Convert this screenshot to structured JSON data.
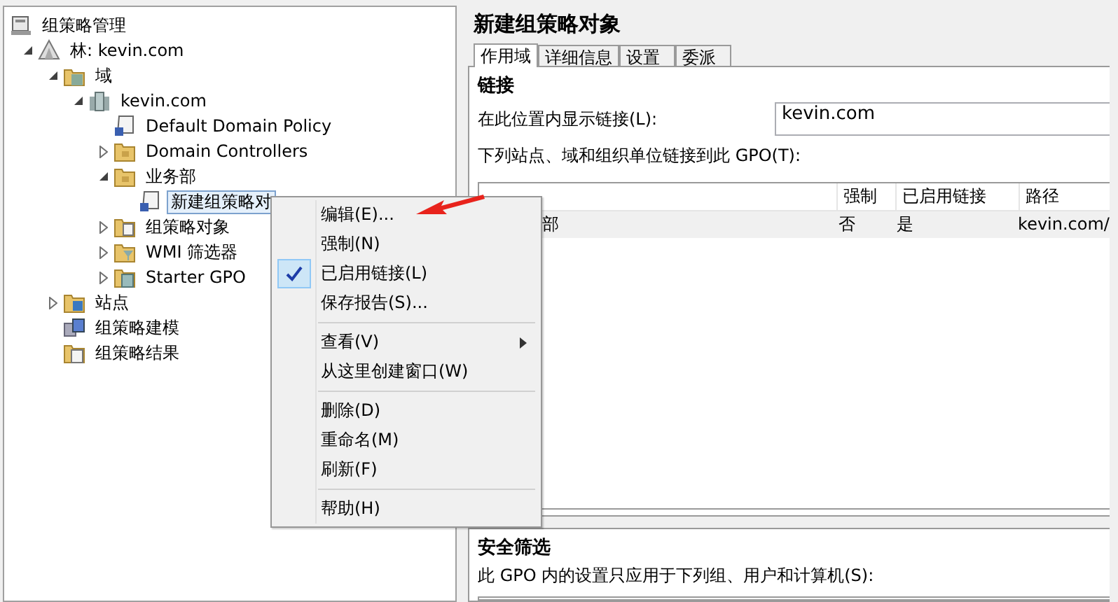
{
  "tree": [
    {
      "label": "组策略管理",
      "kind": "console",
      "selected": false,
      "children": [
        {
          "label": "林: kevin.com",
          "kind": "forest",
          "expanded": true,
          "selected": false,
          "children": [
            {
              "label": "域",
              "kind": "domains",
              "expanded": true,
              "selected": false,
              "children": [
                {
                  "label": "kevin.com",
                  "kind": "domain",
                  "expanded": true,
                  "selected": false,
                  "children": [
                    {
                      "label": "Default Domain Policy",
                      "kind": "gpo",
                      "selected": false
                    },
                    {
                      "label": "Domain Controllers",
                      "kind": "ou",
                      "expanded": false,
                      "selected": false
                    },
                    {
                      "label": "业务部",
                      "kind": "ou",
                      "expanded": true,
                      "selected": false,
                      "children": [
                        {
                          "label": "新建组策略对",
                          "kind": "gpo",
                          "selected": true
                        }
                      ]
                    },
                    {
                      "label": "组策略对象",
                      "kind": "gpofolder",
                      "expanded": false,
                      "selected": false
                    },
                    {
                      "label": "WMI 筛选器",
                      "kind": "wmi",
                      "expanded": false,
                      "selected": false
                    },
                    {
                      "label": "Starter GPO",
                      "kind": "starter",
                      "expanded": false,
                      "selected": false
                    }
                  ]
                }
              ]
            },
            {
              "label": "站点",
              "kind": "sites",
              "expanded": false,
              "selected": false
            },
            {
              "label": "组策略建模",
              "kind": "modeling",
              "selected": false
            },
            {
              "label": "组策略结果",
              "kind": "results",
              "selected": false
            }
          ]
        }
      ]
    }
  ],
  "details": {
    "title": "新建组策略对象",
    "tabs": [
      {
        "label": "作用域",
        "selected": true
      },
      {
        "label": "详细信息",
        "selected": false
      },
      {
        "label": "设置",
        "selected": false
      },
      {
        "label": "委派",
        "selected": false
      }
    ],
    "links": {
      "heading": "链接",
      "location_label": "在此位置内显示链接(L):",
      "location_value": "kevin.com",
      "list_label": "下列站点、域和组织单位链接到此 GPO(T):",
      "table": {
        "columns": [
          "",
          "强制",
          "已启用链接",
          "路径"
        ],
        "rows": [
          {
            "cells": [
              "部",
              "否",
              "是",
              "kevin.com/"
            ],
            "selected": true
          }
        ]
      }
    },
    "security": {
      "heading": "安全筛选",
      "label": "此 GPO 内的设置只应用于下列组、用户和计算机(S):"
    }
  },
  "context_menu": {
    "items": [
      {
        "kind": "item",
        "label": "编辑(E)...",
        "checked": false,
        "submenu": false
      },
      {
        "kind": "item",
        "label": "强制(N)",
        "checked": false,
        "submenu": false
      },
      {
        "kind": "item",
        "label": "已启用链接(L)",
        "checked": true,
        "submenu": false
      },
      {
        "kind": "item",
        "label": "保存报告(S)...",
        "checked": false,
        "submenu": false
      },
      {
        "kind": "separator"
      },
      {
        "kind": "item",
        "label": "查看(V)",
        "checked": false,
        "submenu": true
      },
      {
        "kind": "item",
        "label": "从这里创建窗口(W)",
        "checked": false,
        "submenu": false
      },
      {
        "kind": "separator"
      },
      {
        "kind": "item",
        "label": "删除(D)",
        "checked": false,
        "submenu": false
      },
      {
        "kind": "item",
        "label": "重命名(M)",
        "checked": false,
        "submenu": false
      },
      {
        "kind": "item",
        "label": "刷新(F)",
        "checked": false,
        "submenu": false
      },
      {
        "kind": "separator"
      },
      {
        "kind": "item",
        "label": "帮助(H)",
        "checked": false,
        "submenu": false
      }
    ]
  }
}
